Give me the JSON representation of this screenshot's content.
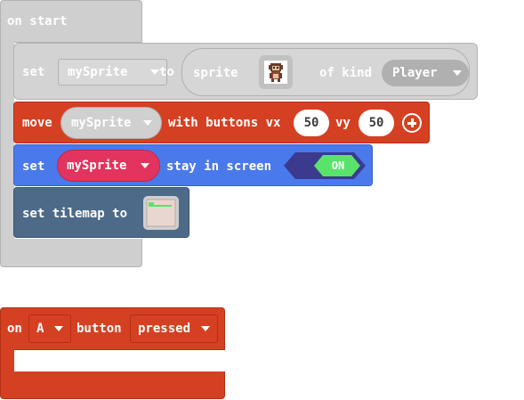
{
  "on_start": {
    "label": "on start",
    "set_row": {
      "set_label": "set",
      "variable": "mySprite",
      "to_label": "to",
      "sprite_label": "sprite",
      "of_kind_label": "of kind",
      "kind_value": "Player"
    },
    "move_row": {
      "move_label": "move",
      "variable": "mySprite",
      "with_buttons_label": "with buttons vx",
      "vx": "50",
      "vy_label": "vy",
      "vy": "50"
    },
    "stay_row": {
      "set_label": "set",
      "variable": "mySprite",
      "stay_label": "stay in screen",
      "toggle": "ON"
    },
    "tilemap_row": {
      "label": "set tilemap to"
    }
  },
  "on_button": {
    "on_label": "on",
    "button_value": "A",
    "button_label": "button",
    "event_value": "pressed"
  },
  "colors": {
    "event_red": "#d64022",
    "sprites_blue": "#4a79ec",
    "variable_pink": "#e2345e",
    "scene_slate": "#4d6a88",
    "toggle_green": "#59e36b",
    "disabled_gray": "#cfcfcf"
  },
  "icons": {
    "sprite_image": "monkey-sprite-icon",
    "tilemap_image": "tilemap-thumbnail-icon",
    "add_param": "plus-circle-icon",
    "dropdown": "caret-down-icon"
  }
}
